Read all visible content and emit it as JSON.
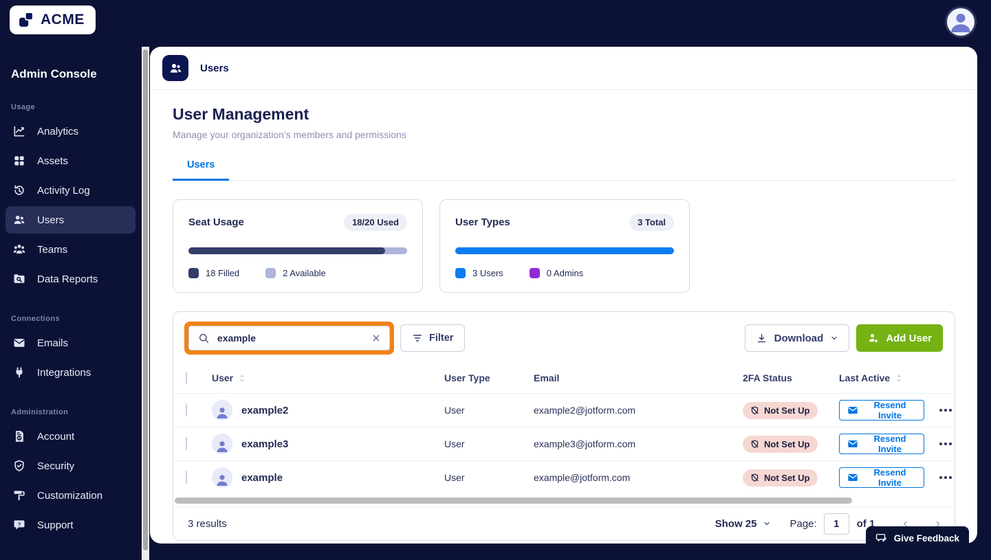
{
  "brand": {
    "logo_text": "ACME"
  },
  "sidebar": {
    "title": "Admin Console",
    "sections": [
      {
        "label": "Usage",
        "items": [
          {
            "label": "Analytics",
            "icon": "analytics-icon",
            "active": false
          },
          {
            "label": "Assets",
            "icon": "assets-icon",
            "active": false
          },
          {
            "label": "Activity Log",
            "icon": "activity-log-icon",
            "active": false
          },
          {
            "label": "Users",
            "icon": "users-icon",
            "active": true
          },
          {
            "label": "Teams",
            "icon": "teams-icon",
            "active": false
          },
          {
            "label": "Data Reports",
            "icon": "data-reports-icon",
            "active": false
          }
        ]
      },
      {
        "label": "Connections",
        "items": [
          {
            "label": "Emails",
            "icon": "email-icon",
            "active": false
          },
          {
            "label": "Integrations",
            "icon": "integrations-icon",
            "active": false
          }
        ]
      },
      {
        "label": "Administration",
        "items": [
          {
            "label": "Account",
            "icon": "account-icon",
            "active": false
          },
          {
            "label": "Security",
            "icon": "security-icon",
            "active": false
          },
          {
            "label": "Customization",
            "icon": "customization-icon",
            "active": false
          },
          {
            "label": "Support",
            "icon": "support-icon",
            "active": false
          }
        ]
      }
    ]
  },
  "header": {
    "page_label": "Users"
  },
  "main": {
    "title": "User Management",
    "subtitle": "Manage your organization’s members and permissions",
    "tabs": [
      {
        "label": "Users",
        "active": true
      }
    ],
    "cards": [
      {
        "title": "Seat Usage",
        "badge": "18/20 Used",
        "bar": {
          "filled_pct": 90,
          "filled_color": "#343C6A",
          "rest_color": "#AEB6DC"
        },
        "legend": [
          {
            "label": "18 Filled",
            "color": "#343C6A"
          },
          {
            "label": "2 Available",
            "color": "#AEB6DC"
          }
        ]
      },
      {
        "title": "User Types",
        "badge": "3 Total",
        "bar": {
          "filled_pct": 100,
          "filled_color": "#0D7DF2",
          "rest_color": "#0D7DF2"
        },
        "legend": [
          {
            "label": "3 Users",
            "color": "#0D7DF2"
          },
          {
            "label": "0 Admins",
            "color": "#8F2AD4"
          }
        ]
      }
    ],
    "toolbar": {
      "search_value": "example",
      "filter_label": "Filter",
      "download_label": "Download",
      "add_user_label": "Add User",
      "highlight_color": "#F38216"
    },
    "table": {
      "columns": [
        "User",
        "User Type",
        "Email",
        "2FA Status",
        "Last Active"
      ],
      "rows": [
        {
          "name": "example2",
          "type": "User",
          "email": "example2@jotform.com",
          "tfa": "Not Set Up",
          "tfa_icon": "shield-slash-icon",
          "action": "Resend Invite",
          "action_icon": "envelope-icon"
        },
        {
          "name": "example3",
          "type": "User",
          "email": "example3@jotform.com",
          "tfa": "Not Set Up",
          "tfa_icon": "shield-slash-icon",
          "action": "Resend Invite",
          "action_icon": "envelope-icon"
        },
        {
          "name": "example",
          "type": "User",
          "email": "example@jotform.com",
          "tfa": "Not Set Up",
          "tfa_icon": "shield-slash-icon",
          "action": "Resend Invite",
          "action_icon": "envelope-icon"
        }
      ]
    },
    "footer": {
      "results_text": "3 results",
      "show_label": "Show 25",
      "page_label": "Page:",
      "page_value": "1",
      "of_label": "of 1"
    }
  },
  "feedback": {
    "label": "Give Feedback"
  },
  "colors": {
    "background_navy": "#0B1235",
    "accent_blue": "#0075E3",
    "add_user_green": "#76B213",
    "tfa_pill_bg": "#F6D8D2"
  }
}
